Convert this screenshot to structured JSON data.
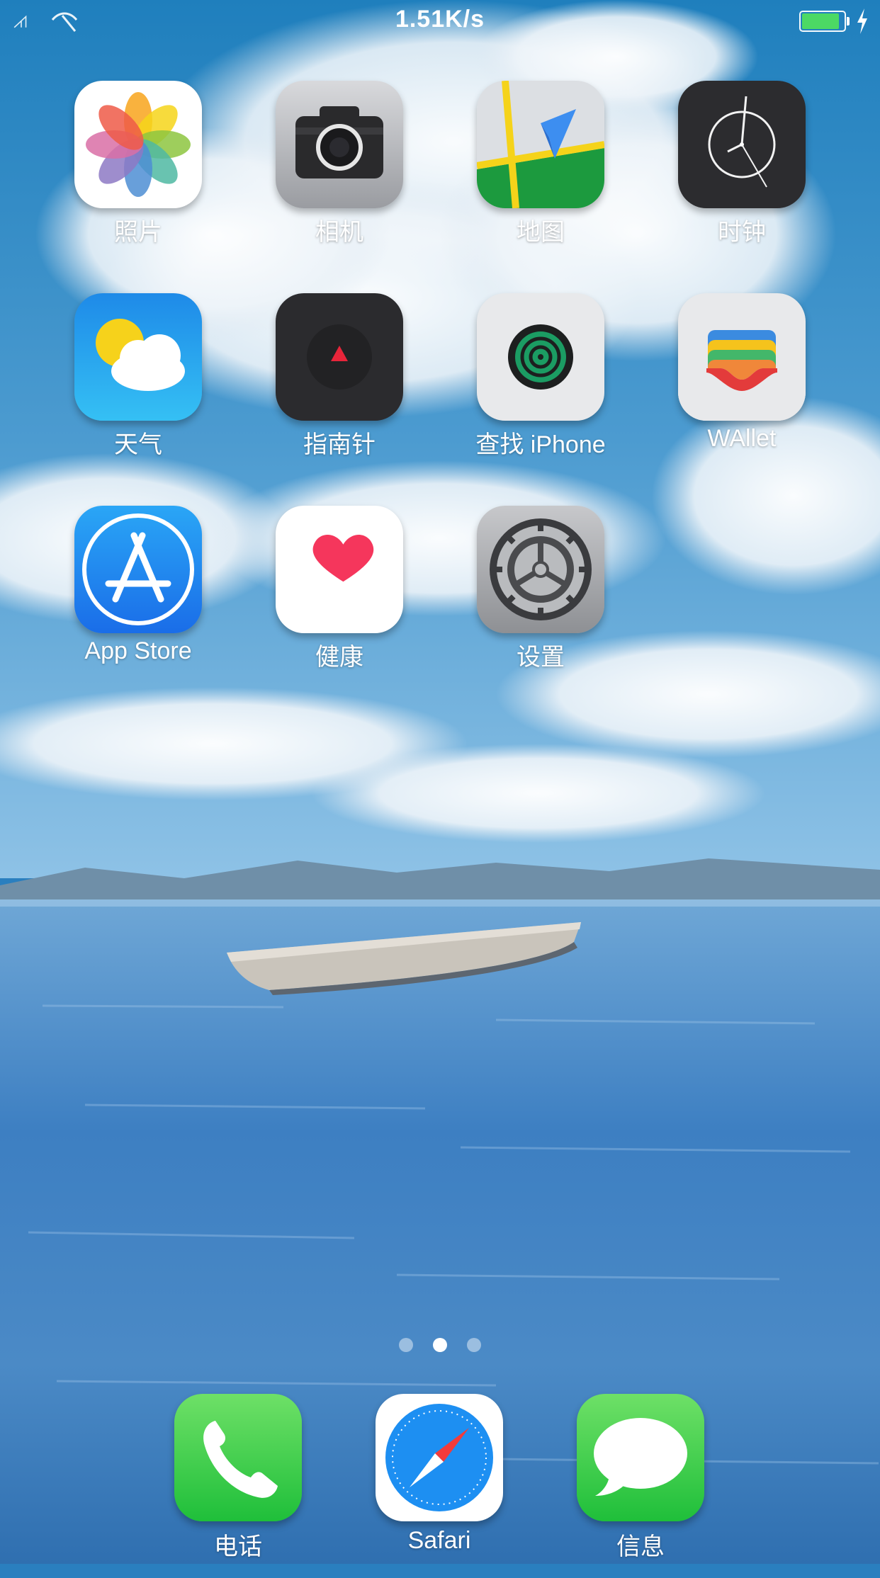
{
  "status_bar": {
    "network_speed": "1.51K/s",
    "battery_level": 0.9,
    "battery_color": "#4cd964",
    "left_icons": [
      "signal-icon",
      "wifi-icon"
    ],
    "right_icons": [
      "battery-icon",
      "charging-bolt-icon"
    ]
  },
  "home": {
    "apps": [
      {
        "label": "照片",
        "icon": "photos-icon"
      },
      {
        "label": "相机",
        "icon": "camera-icon"
      },
      {
        "label": "地图",
        "icon": "maps-icon"
      },
      {
        "label": "时钟",
        "icon": "clock-icon"
      },
      {
        "label": "天气",
        "icon": "weather-icon"
      },
      {
        "label": "指南针",
        "icon": "compass-icon"
      },
      {
        "label": "查找 iPhone",
        "icon": "find-iphone-icon"
      },
      {
        "label": "WAllet",
        "icon": "wallet-icon"
      },
      {
        "label": "App Store",
        "icon": "app-store-icon"
      },
      {
        "label": "健康",
        "icon": "health-icon"
      },
      {
        "label": "设置",
        "icon": "settings-icon"
      }
    ]
  },
  "page_indicator": {
    "pages": 3,
    "current": 2
  },
  "dock": {
    "apps": [
      {
        "label": "电话",
        "icon": "phone-icon"
      },
      {
        "label": "Safari",
        "icon": "safari-icon"
      },
      {
        "label": "信息",
        "icon": "messages-icon"
      }
    ]
  }
}
